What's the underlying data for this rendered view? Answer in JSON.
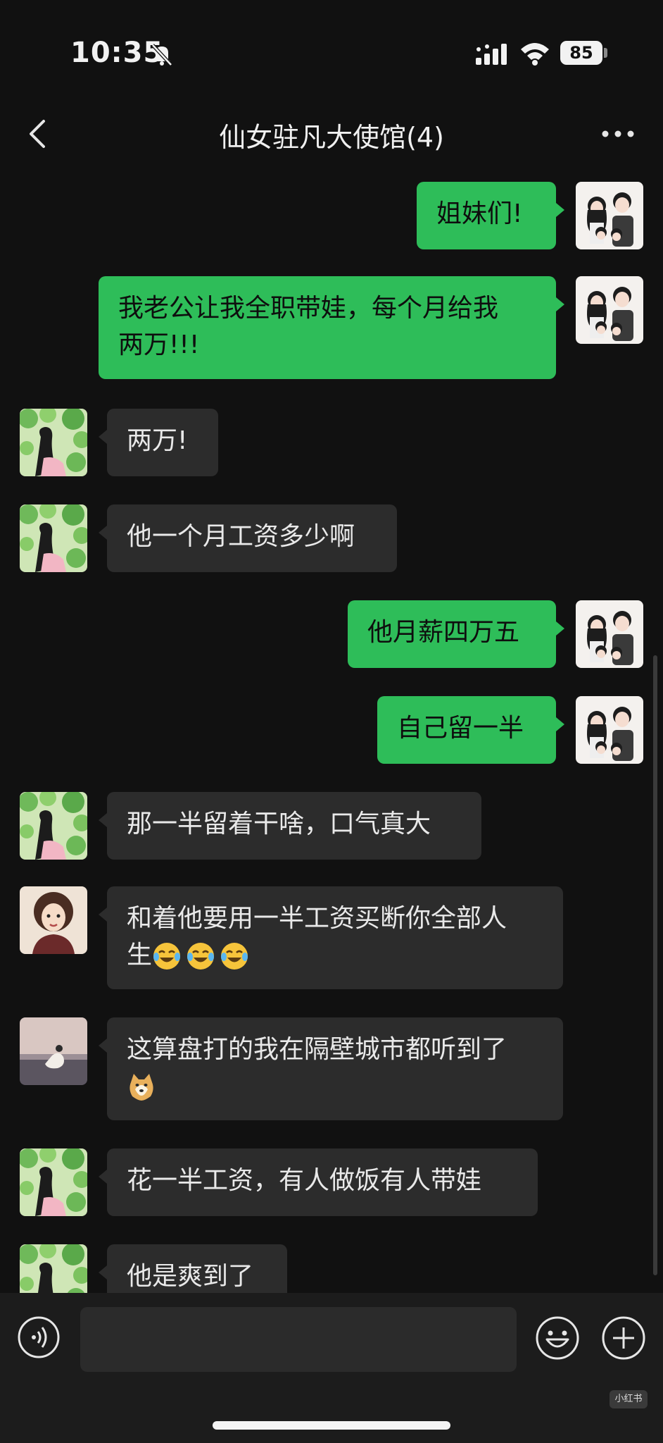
{
  "status_bar": {
    "time": "10:35",
    "battery": "85"
  },
  "header": {
    "title": "仙女驻凡大使馆(4)"
  },
  "messages": [
    {
      "sender": "me",
      "avatar": "family-avatar",
      "text": "姐妹们!"
    },
    {
      "sender": "me",
      "avatar": "family-avatar",
      "text": "我老公让我全职带娃，每个月给我\n两万!!!"
    },
    {
      "sender": "other",
      "avatar": "green-leaf-avatar",
      "text": "两万!"
    },
    {
      "sender": "other",
      "avatar": "green-leaf-avatar",
      "text": "他一个月工资多少啊"
    },
    {
      "sender": "me",
      "avatar": "family-avatar",
      "text": "他月薪四万五"
    },
    {
      "sender": "me",
      "avatar": "family-avatar",
      "text": "自己留一半"
    },
    {
      "sender": "other",
      "avatar": "green-leaf-avatar",
      "text": "那一半留着干啥，口气真大"
    },
    {
      "sender": "other",
      "avatar": "cartoon-woman-avatar",
      "text": "和着他要用一半工资买断你全部人\n生",
      "emojis": [
        "laugh-cry-emoji",
        "laugh-cry-emoji",
        "laugh-cry-emoji"
      ]
    },
    {
      "sender": "other",
      "avatar": "beach-avatar",
      "text": "这算盘打的我在隔壁城市都听到了",
      "emojis": [
        "doge-emoji"
      ]
    },
    {
      "sender": "other",
      "avatar": "green-leaf-avatar",
      "text": "花一半工资，有人做饭有人带娃"
    },
    {
      "sender": "other",
      "avatar": "green-leaf-avatar",
      "text": "他是爽到了"
    }
  ],
  "input_bar": {
    "placeholder": "",
    "watermark": "小红书"
  },
  "colors": {
    "my_bubble": "#2ebd59",
    "other_bubble": "#2c2c2c",
    "background": "#111111"
  }
}
